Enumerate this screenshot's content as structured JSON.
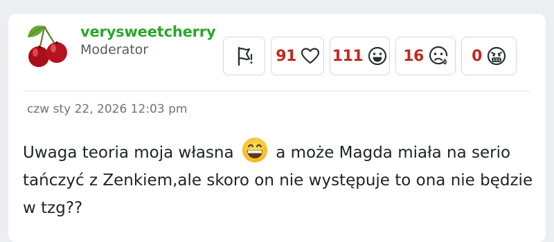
{
  "user": {
    "name": "verysweetcherry",
    "role": "Moderator",
    "avatar_icon": "cherries-icon"
  },
  "actions": {
    "flag_icon": "flag-icon",
    "love_count": "91",
    "haha_count": "111",
    "sad_count": "16",
    "angry_count": "0"
  },
  "post": {
    "date": "czw sty 22, 2026 12:03 pm",
    "text_before_emoji": "Uwaga teoria moja własna",
    "text_after_emoji": "a może Magda miała na serio tańczyć z Zenkiem,ale skoro on nie występuje to ona nie będzie w tzg??",
    "emoji_icon": "grinning-face-emoji"
  },
  "colors": {
    "username": "#2ca52c",
    "count": "#c2281f",
    "page_bg": "#eceef1"
  }
}
